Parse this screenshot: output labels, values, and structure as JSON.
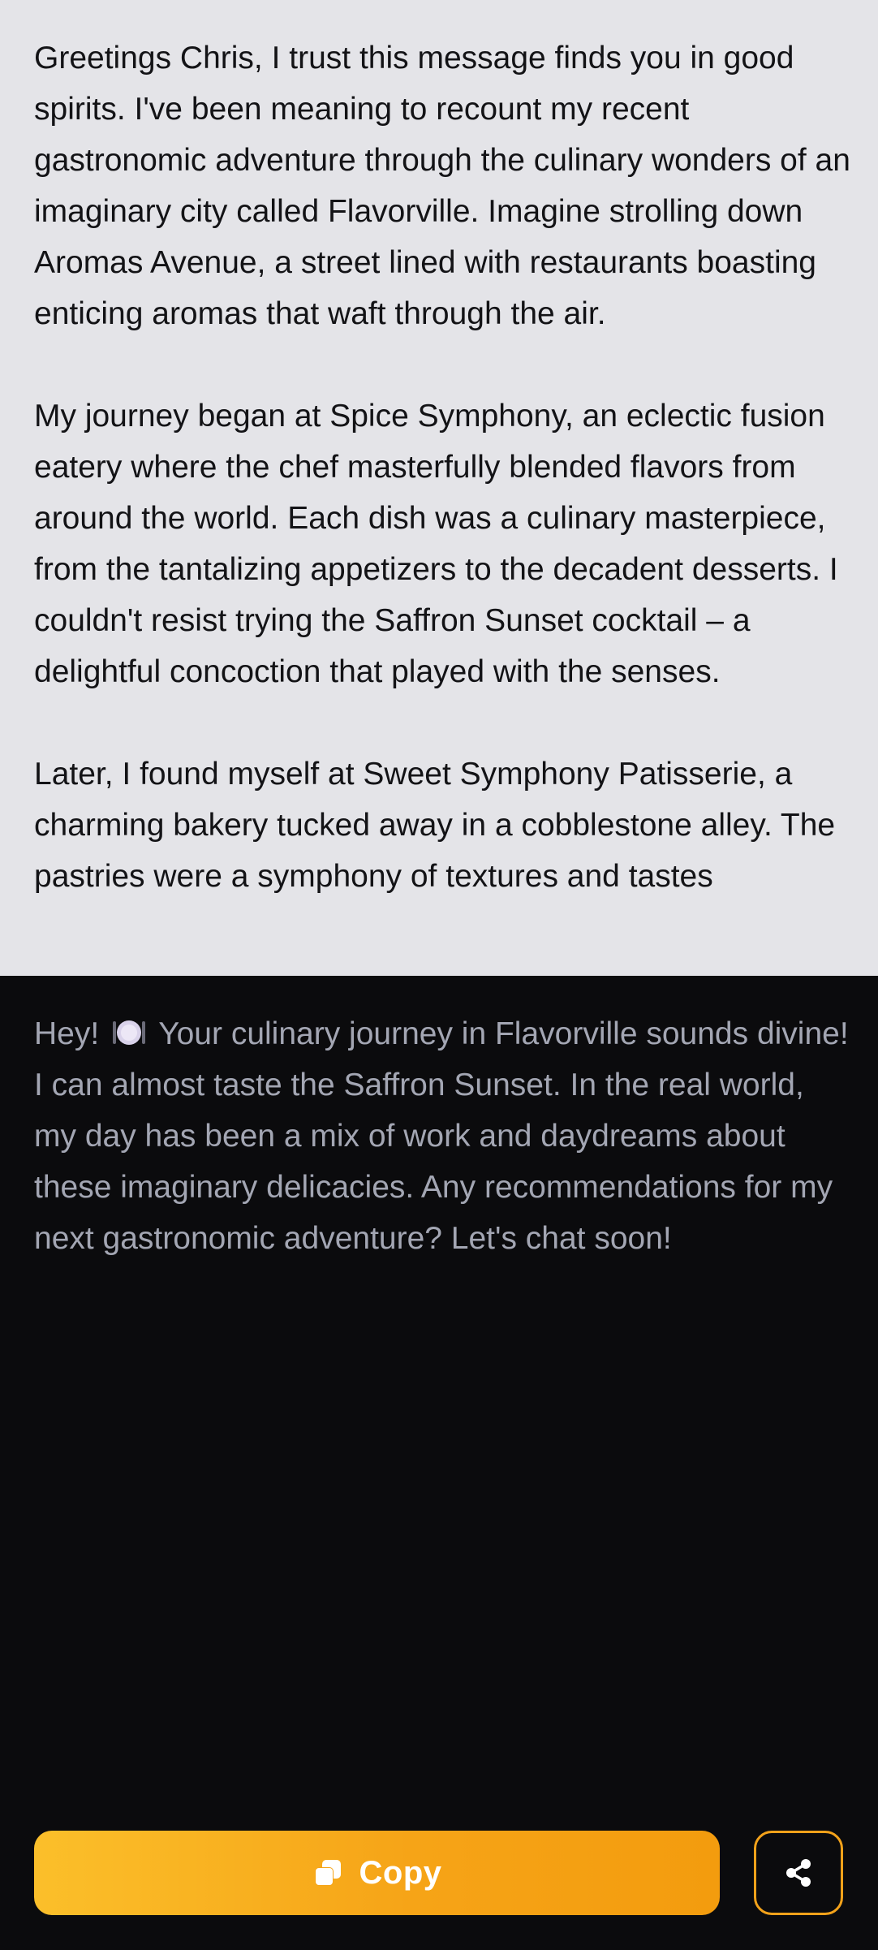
{
  "original_message": {
    "text": "Greetings Chris, I trust this message finds you in good spirits. I've been meaning to recount my recent gastronomic adventure through the culinary wonders of an imaginary city called Flavorville. Imagine strolling down Aromas Avenue, a street lined with restaurants boasting enticing aromas that waft through the air.\n\nMy journey began at Spice Symphony, an eclectic fusion eatery where the chef masterfully blended flavors from around the world. Each dish was a culinary masterpiece, from the tantalizing appetizers to the decadent desserts. I couldn't resist trying the Saffron Sunset cocktail – a delightful concoction that played with the senses.\n\nLater, I found myself at Sweet Symphony Patisserie, a charming bakery tucked away in a cobblestone alley. The pastries were a symphony of textures and tastes"
  },
  "reply": {
    "greeting": "Hey!",
    "emoji_icon": "plate-with-cutlery-icon",
    "text": "Your culinary journey in Flavorville sounds divine! I can almost taste the Saffron Sunset. In the real world, my day has been a mix of work and daydreams about these imaginary delicacies. Any recommendations for my next gastronomic adventure? Let's chat soon!"
  },
  "actions": {
    "copy_label": "Copy",
    "copy_icon": "copy-icon",
    "share_icon": "share-icon"
  },
  "colors": {
    "top_background": "#e4e4e8",
    "reply_background": "#0b0b0d",
    "reply_text": "#a3a6b3",
    "accent": "#f6a417"
  }
}
